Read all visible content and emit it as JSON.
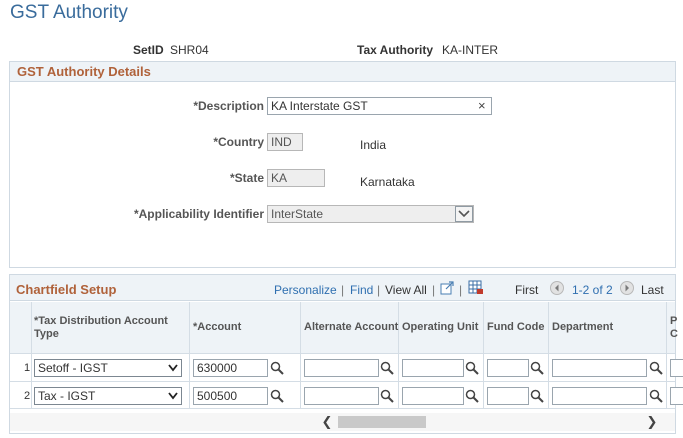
{
  "page": {
    "title": "GST Authority"
  },
  "header": {
    "setid_label": "SetID",
    "setid_value": "SHR04",
    "tax_authority_label": "Tax Authority",
    "tax_authority_value": "KA-INTER"
  },
  "details": {
    "title": "GST Authority Details",
    "description_label": "*Description",
    "description_value": "KA Interstate GST",
    "country_label": "*Country",
    "country_code": "IND",
    "country_name": "India",
    "state_label": "*State",
    "state_code": "KA",
    "state_name": "Karnataka",
    "applicability_label": "*Applicability Identifier",
    "applicability_value": "InterState"
  },
  "chartfield": {
    "title": "Chartfield Setup",
    "toolbar": {
      "personalize": "Personalize",
      "find": "Find",
      "view_all": "View All",
      "first": "First",
      "range": "1-2 of 2",
      "last": "Last",
      "sep": "|"
    },
    "columns": {
      "tax_dist": "*Tax Distribution Account Type",
      "account": "*Account",
      "alt_account": "Alternate Account",
      "oper_unit": "Operating Unit",
      "fund_code": "Fund Code",
      "department": "Department",
      "partial": "P C"
    },
    "rows": [
      {
        "num": "1",
        "tax_dist": "Setoff - IGST",
        "account": "630000"
      },
      {
        "num": "2",
        "tax_dist": "Tax - IGST",
        "account": "500500"
      }
    ]
  },
  "icons": {
    "clear": "×",
    "scroll_left": "❮",
    "scroll_right": "❯"
  }
}
